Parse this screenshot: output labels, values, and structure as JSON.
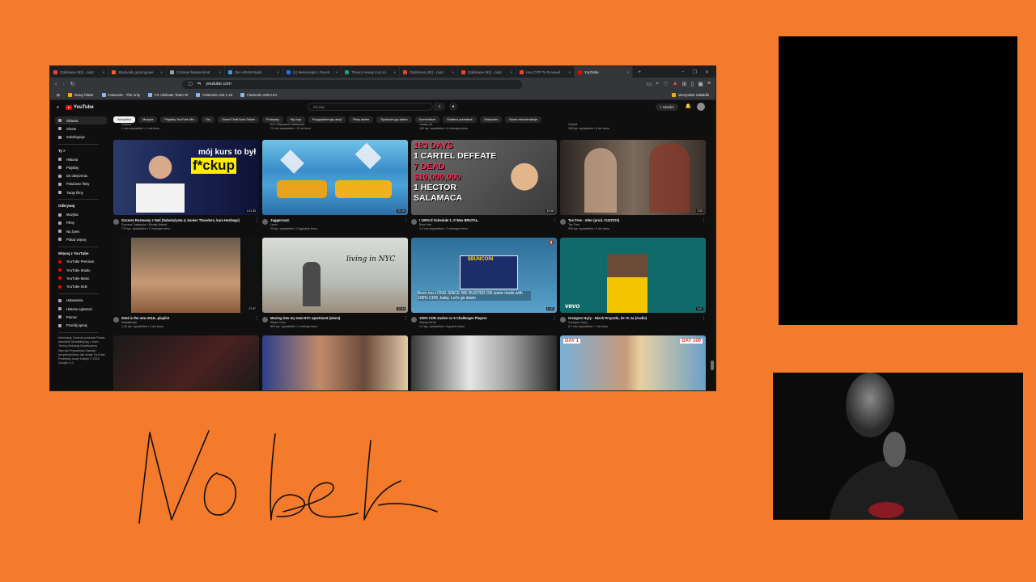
{
  "browser": {
    "tabs": [
      {
        "label": "Odebrane (82) - piotr",
        "color": "#ea4335"
      },
      {
        "label": "Stackoski gamingowe",
        "color": "#ff5722"
      },
      {
        "label": "Criminal Mastermind",
        "color": "#9e9e9e"
      },
      {
        "label": "Zeri ARAM Build",
        "color": "#3d9cd8"
      },
      {
        "label": "(1) Messenger | Faceb",
        "color": "#1877f2"
      },
      {
        "label": "Theory Heavy Icon Ki",
        "color": "#10a37f"
      },
      {
        "label": "Odebrane (82) - piotr",
        "color": "#ea4335"
      },
      {
        "label": "Odebrane (82) - piotr",
        "color": "#ea4335"
      },
      {
        "label": "Use OTP To Proceed",
        "color": "#ea4335"
      },
      {
        "label": "YouTube",
        "color": "#ff0000",
        "active": true
      }
    ],
    "new_tab": "+",
    "url": "youtube.com",
    "bookmarks": [
      "Nowy folder",
      "Faietools - The only",
      "FC Ultimate Team W",
      "Faietools v25.1.24",
      "Faietools v28.0.24"
    ],
    "bookmarks_end": "Wszystkie zakładki"
  },
  "youtube": {
    "logo": "YouTube",
    "search_placeholder": "Szukaj",
    "create_label": "+ Utwórz",
    "chips": [
      "Wszystkie",
      "Muzyka",
      "Playlisty YouTube Mix",
      "Gry",
      "Grand Theft Auto Online",
      "Podcasty",
      "Hip-hop",
      "Przygodowe gry akcji",
      "Filmy anime",
      "Sportowe gry wideo",
      "Komentarze",
      "Ostatnio przesłane",
      "Obejrzane",
      "Nowe rekomendacje"
    ],
    "sidebar": {
      "main": [
        {
          "label": "Główna",
          "active": true
        },
        {
          "label": "Shorts"
        },
        {
          "label": "Subskrypcje"
        }
      ],
      "you_header": "Ty >",
      "you": [
        "Historia",
        "Playlisty",
        "Do obejrzenia",
        "Polubione filmy",
        "Twoje filmy"
      ],
      "explore_header": "Odkrywaj",
      "explore": [
        "Muzyka",
        "Filmy",
        "Na żywo",
        "Pokaż więcej"
      ],
      "more_header": "Więcej z YouTube",
      "more": [
        "YouTube Premium",
        "YouTube Studio",
        "YouTube Music",
        "YouTube Kids"
      ],
      "settings": [
        "Ustawienia",
        "Historia zgłoszeń",
        "Pomoc",
        "Prześlij opinię"
      ],
      "footer": "Informacje  Centrum prasowe  Prawa autorskie  Skontaktuj się z nami  Twórcy  Reklamy  Deweloperzy  Warunki  Prywatność  Zasady i bezpieczeństwo  Jak działa YouTube  Przetestuj nowe funkcje  © 2025 Google LLC"
    },
    "top_row_meta": [
      {
        "channel": "Pasbrut",
        "views": "1 mln wyświetleń • 1 rok temu"
      },
      {
        "channel": "ECU Wyzwanie Wiedzowe",
        "views": "72 mln wyświetleń • 10 lat temu"
      },
      {
        "channel": "Hanak_bll",
        "views": "100 tys. wyświetleń • 6 miesięcy temu"
      },
      {
        "channel": "Urbsoll",
        "views": "108 tys. wyświetleń • 5 dni temu"
      }
    ],
    "videos": [
      {
        "title": "Szczere Rozmowy z Nati (Sabotażysta 4, koniec Thunders, kara Hezbego)",
        "channel": "Szczera Tradauduc i Moniej Walca)",
        "views": "770 tys. wyświetleń • 2 miesiące temu",
        "duration": "1:41:33",
        "overlay1": "mój kurs to był",
        "overlay2": "f*ckup"
      },
      {
        "title": "Juggernaut.",
        "channel": "Lemo",
        "views": "29 tys. wyświetleń • 2 tygodnie temu",
        "duration": "20:19"
      },
      {
        "title": "I 100%'d Schedule 1. It Was BRUTAL.",
        "channel": "Buor Arts",
        "views": "1,4 mln wyświetleń • 2 miesiące temu",
        "duration": "33:08",
        "lines": [
          "183 DAYS",
          "1 CARTEL DEFEATE",
          "7 DEAD",
          "$10,000,000",
          "1 HECTOR",
          "SALAMACA"
        ]
      },
      {
        "title": "Tax Free - Alter (prod. CUZOO3)",
        "channel": "Tax Free",
        "views": "906 tys. wyświetleń • 4 dni temu",
        "duration": "3:33"
      },
      {
        "title": "2024 is the new 2016...playlist",
        "channel": "Destatenaie",
        "views": "1,03 tys. wyświetleń • 4 dni temu",
        "duration": "27:07"
      },
      {
        "title": "Moving into my new NYC apartment (alone)",
        "channel": "Ethan Chou",
        "views": "893 tys. wyświetleń • 1 miesiąc temu",
        "duration": "12:34",
        "overlay1": "living in NYC"
      },
      {
        "title": "100% CDR Zaslen vs 5 Challenger Players",
        "channel": "SweepToFire",
        "views": "1,2 tys. wyświetleń • 8 godzin temu",
        "duration": "11:53",
        "overlay1": "$BUNCOIN",
        "overlay2": "Been too LONG SINCE WE BUSTED ON some mods with 100% CDR, baby. Let's go down"
      },
      {
        "title": "Grzegorz Hyży - Niech Przyszło, Że To Ja (Audio)",
        "channel": "Grzegorz Hyży",
        "views": "8,7 mln wyświetleń • 7 lat temu",
        "duration": "3:47",
        "overlay1": "vevo"
      }
    ],
    "bottom_row": {
      "overlay_left": "DAY 1",
      "overlay_right": "DAY 100"
    }
  },
  "handwriting": "Nobek",
  "colors": {
    "background": "#f47a2c",
    "yt_bg": "#0f0f0f",
    "accent": "#ff0000"
  }
}
